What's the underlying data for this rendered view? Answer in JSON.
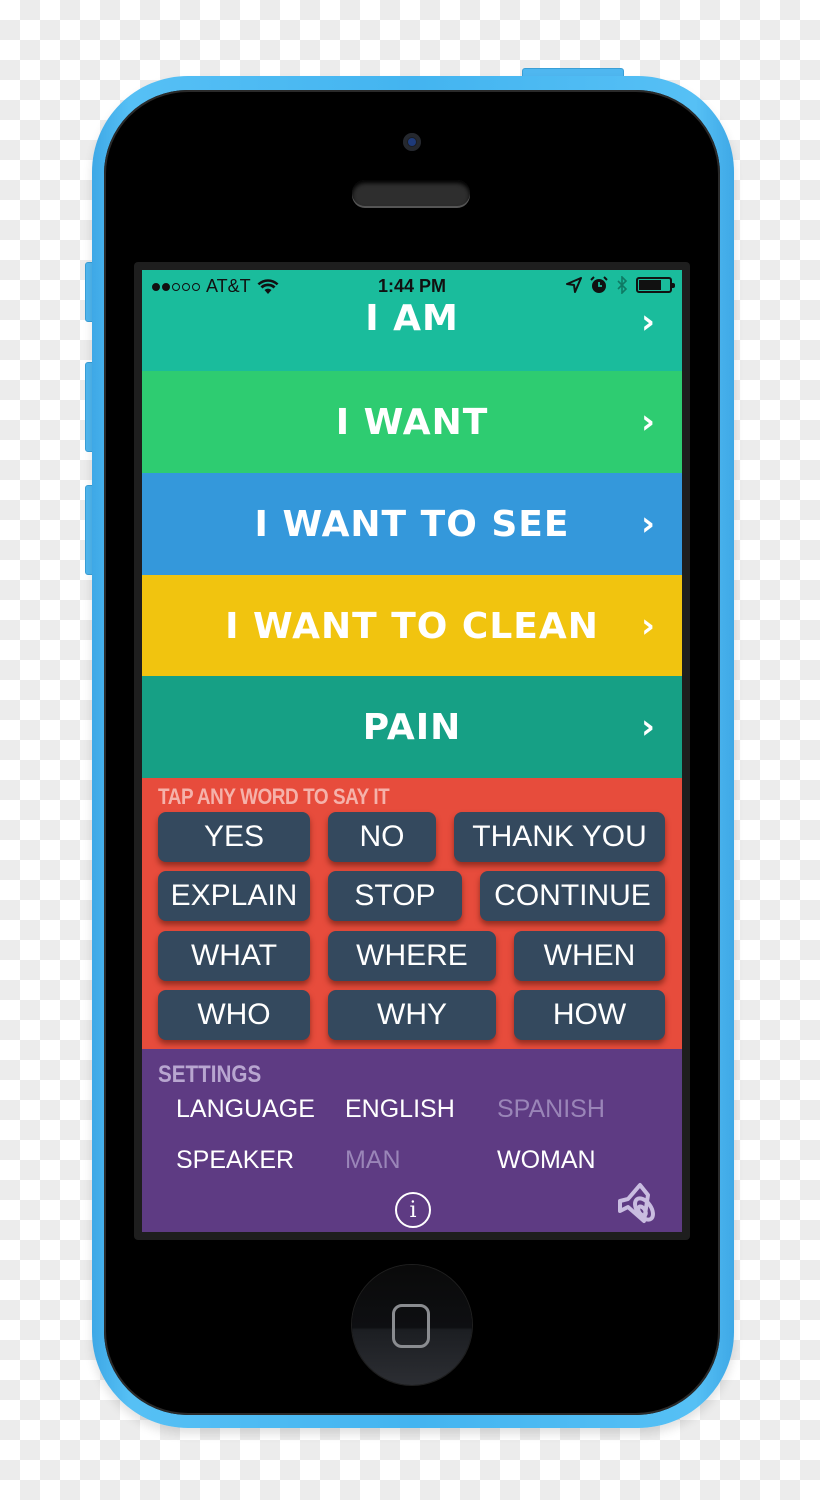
{
  "status_bar": {
    "carrier": "AT&T",
    "signal_strength": 2,
    "signal_max": 5,
    "time": "1:44 PM",
    "battery_level": 0.65
  },
  "categories": [
    {
      "label": "I AM",
      "color": "#1abc9c",
      "icon": "chevron-right-icon"
    },
    {
      "label": "I WANT",
      "color": "#2ecc71",
      "icon": "chevron-right-icon"
    },
    {
      "label": "I WANT TO SEE",
      "color": "#3498db",
      "icon": "chevron-right-icon"
    },
    {
      "label": "I WANT TO CLEAN",
      "color": "#f1c40f",
      "icon": "chevron-right-icon"
    },
    {
      "label": "PAIN",
      "color": "#16a085",
      "icon": "chevron-right-icon"
    }
  ],
  "chevron_glyph": "›",
  "quick_words": {
    "title": "TAP ANY WORD TO SAY IT",
    "words": [
      "YES",
      "NO",
      "THANK YOU",
      "EXPLAIN",
      "STOP",
      "CONTINUE",
      "WHAT",
      "WHERE",
      "WHEN",
      "WHO",
      "WHY",
      "HOW"
    ]
  },
  "settings": {
    "title": "SETTINGS",
    "language": {
      "label": "LANGUAGE",
      "options": [
        "ENGLISH",
        "SPANISH"
      ],
      "selected": "ENGLISH"
    },
    "speaker": {
      "label": "SPEAKER",
      "options": [
        "MAN",
        "WOMAN"
      ],
      "selected": "WOMAN"
    },
    "info_glyph": "i"
  },
  "colors": {
    "words_bg": "#e74c3c",
    "word_button": "#34495e",
    "settings_bg": "#5e3b83",
    "phone_body": "#43b4f0"
  }
}
